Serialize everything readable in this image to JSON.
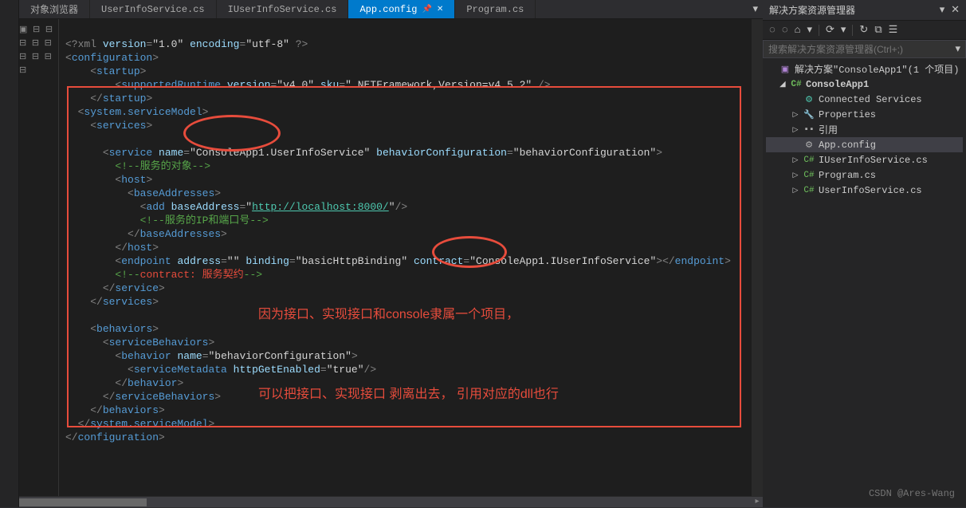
{
  "tabs": {
    "t0": "对象浏览器",
    "t1": "UserInfoService.cs",
    "t2": "IUserInfoService.cs",
    "t3": "App.config",
    "t4": "Program.cs"
  },
  "code": {
    "l1a": "<?xml",
    "l1b": "version",
    "l1c": "\"1.0\"",
    "l1d": "encoding",
    "l1e": "\"utf-8\"",
    "l1f": "?>",
    "l2a": "<",
    "l2b": "configuration",
    "l2c": ">",
    "l3a": "<",
    "l3b": "startup",
    "l3c": ">",
    "l4a": "<",
    "l4b": "supportedRuntime",
    "l4c": "version",
    "l4d": "\"v4.0\"",
    "l4e": "sku",
    "l4f": "\".NETFramework,Version=v4.5.2\"",
    "l4g": "/>",
    "l5a": "</",
    "l5b": "startup",
    "l5c": ">",
    "l6a": "<",
    "l6b": "system.serviceModel",
    "l6c": ">",
    "l7a": "<",
    "l7b": "services",
    "l7c": ">",
    "l9a": "<",
    "l9b": "service",
    "l9c": "name",
    "l9d": "\"ConsoleApp1.UserInfoService\"",
    "l9e": "behaviorConfiguration",
    "l9f": "\"behaviorConfiguration\"",
    "l9g": ">",
    "l10": "<!--服务的对象-->",
    "l11a": "<",
    "l11b": "host",
    "l11c": ">",
    "l12a": "<",
    "l12b": "baseAddresses",
    "l12c": ">",
    "l13a": "<",
    "l13b": "add",
    "l13c": "baseAddress",
    "l13d": "\"",
    "l13e": "http://localhost:8000/",
    "l13f": "\"",
    "l13g": "/>",
    "l14": "<!--服务的IP和端口号-->",
    "l15a": "</",
    "l15b": "baseAddresses",
    "l15c": ">",
    "l16a": "</",
    "l16b": "host",
    "l16c": ">",
    "l17a": "<",
    "l17b": "endpoint",
    "l17c": "address",
    "l17d": "\"\"",
    "l17e": "binding",
    "l17f": "\"basicHttpBinding\"",
    "l17g": "contract",
    "l17h": "\"ConsoleApp1.IUserInfoService\"",
    "l17i": "></",
    "l17j": "endpoint",
    "l17k": ">",
    "l18a": "<!--",
    "l18b": "contract: 服务契约",
    "l18c": "-->",
    "l19a": "</",
    "l19b": "service",
    "l19c": ">",
    "l20a": "</",
    "l20b": "services",
    "l20c": ">",
    "l22a": "<",
    "l22b": "behaviors",
    "l22c": ">",
    "l23a": "<",
    "l23b": "serviceBehaviors",
    "l23c": ">",
    "l24a": "<",
    "l24b": "behavior",
    "l24c": "name",
    "l24d": "\"behaviorConfiguration\"",
    "l24e": ">",
    "l25a": "<",
    "l25b": "serviceMetadata",
    "l25c": "httpGetEnabled",
    "l25d": "\"true\"",
    "l25e": "/>",
    "l26a": "</",
    "l26b": "behavior",
    "l26c": ">",
    "l27a": "</",
    "l27b": "serviceBehaviors",
    "l27c": ">",
    "l28a": "</",
    "l28b": "behaviors",
    "l28c": ">",
    "l29a": "</",
    "l29b": "system.serviceModel",
    "l29c": ">",
    "l30a": "</",
    "l30b": "configuration",
    "l30c": ">"
  },
  "annotations": {
    "a1": "因为接口、实现接口和console隶属一个项目，",
    "a2": "可以把接口、实现接口  剥离出去，  引用对应的dll也行"
  },
  "right": {
    "title": "解决方案资源管理器",
    "search_placeholder": "搜索解决方案资源管理器(Ctrl+;)",
    "sln": "解决方案\"ConsoleApp1\"(1 个项目)",
    "proj": "ConsoleApp1",
    "conn": "Connected Services",
    "prop": "Properties",
    "ref": "引用",
    "f1": "App.config",
    "f2": "IUserInfoService.cs",
    "f3": "Program.cs",
    "f4": "UserInfoService.cs"
  },
  "watermark": "CSDN @Ares-Wang"
}
